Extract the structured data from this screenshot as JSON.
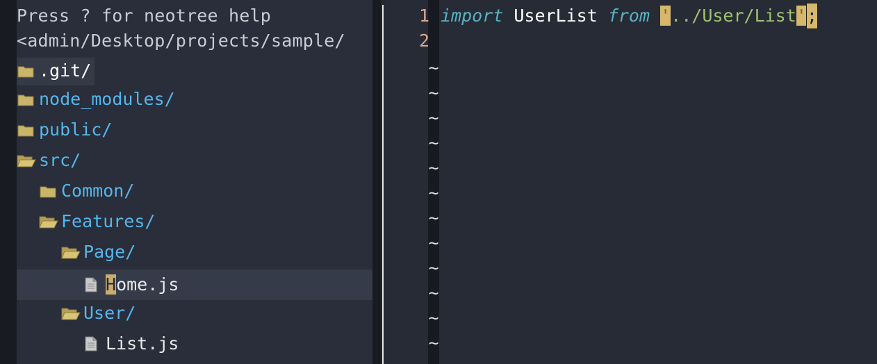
{
  "tree": {
    "help_text": "Press ? for neotree help",
    "root_path": "<admin/Desktop/projects/sample/",
    "items": [
      {
        "name": ".git/",
        "kind": "folder-closed"
      },
      {
        "name": "node_modules/",
        "kind": "folder-closed"
      },
      {
        "name": "public/",
        "kind": "folder-closed"
      },
      {
        "name": "src/",
        "kind": "folder-open"
      },
      {
        "name": "Common/",
        "kind": "folder-closed"
      },
      {
        "name": "Features/",
        "kind": "folder-open"
      },
      {
        "name": "Page/",
        "kind": "folder-open"
      },
      {
        "name": "Home.js",
        "kind": "file",
        "cursor_char": "H",
        "rest": "ome.js"
      },
      {
        "name": "User/",
        "kind": "folder-open"
      },
      {
        "name": "List.js",
        "kind": "file"
      }
    ]
  },
  "editor": {
    "line_numbers": [
      "1",
      "2"
    ],
    "tildes": [
      "~",
      "~",
      "~",
      "~",
      "~",
      "~",
      "~",
      "~",
      "~",
      "~",
      "~",
      "~"
    ],
    "line1": {
      "kw_import": "import",
      "ident": " UserList ",
      "kw_from": "from",
      "space": " ",
      "open_quote": "'",
      "path": "../User/List",
      "close_quote": "'",
      "semicolon": ";"
    }
  },
  "colors": {
    "directory": "#55b6ec",
    "keyword": "#5ab3c1",
    "string": "#9fc36f",
    "line_number": "#d9a98f",
    "match_highlight": "#d7b86a",
    "folder_icon": "#c8b56a"
  },
  "icons": {
    "folder_closed": "folder-icon",
    "folder_open": "folder-open-icon",
    "file": "file-icon"
  }
}
